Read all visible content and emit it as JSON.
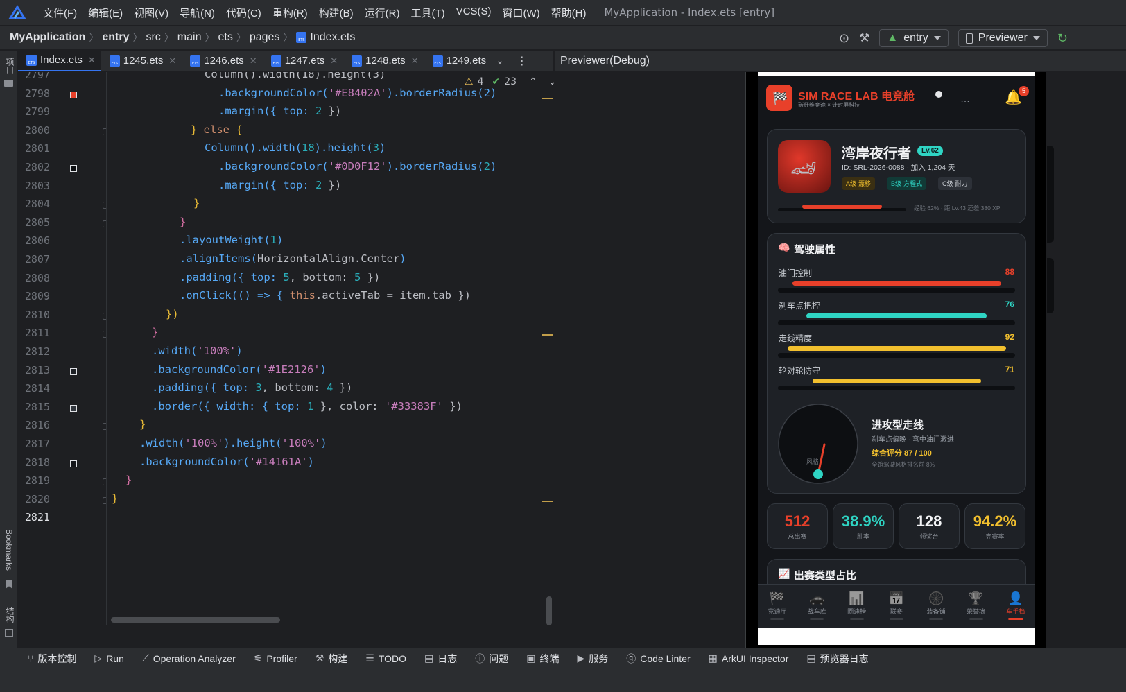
{
  "menu": {
    "items": [
      "文件(F)",
      "编辑(E)",
      "视图(V)",
      "导航(N)",
      "代码(C)",
      "重构(R)",
      "构建(B)",
      "运行(R)",
      "工具(T)",
      "VCS(S)",
      "窗口(W)",
      "帮助(H)"
    ],
    "window_title": "MyApplication - Index.ets [entry]"
  },
  "breadcrumb": [
    "MyApplication",
    "entry",
    "src",
    "main",
    "ets",
    "pages",
    "Index.ets"
  ],
  "toolbar": {
    "module": "entry",
    "device": "Previewer"
  },
  "left_strip": {
    "project": "项目",
    "bookmarks": "Bookmarks",
    "structure": "结构"
  },
  "tabs": [
    "Index.ets",
    "1245.ets",
    "1246.ets",
    "1247.ets",
    "1248.ets",
    "1249.ets"
  ],
  "editor": {
    "warnings": "4",
    "checks": "23",
    "line_numbers": [
      "2797",
      "2798",
      "2799",
      "2800",
      "2801",
      "2802",
      "2803",
      "2804",
      "2805",
      "2806",
      "2807",
      "2808",
      "2809",
      "2810",
      "2811",
      "2812",
      "2813",
      "2814",
      "2815",
      "2816",
      "2817",
      "2818",
      "2819",
      "2820",
      "2821"
    ]
  },
  "code_lines": [
    [
      [
        "Column().width(18).height(3)",
        "p"
      ]
    ],
    [
      [
        ".backgroundColor(",
        "f"
      ],
      [
        "'#E8402A'",
        "s"
      ],
      [
        ").borderRadius(2)",
        "f"
      ]
    ],
    [
      [
        ".margin({ top: ",
        "f"
      ],
      [
        "2",
        "n"
      ],
      [
        " })",
        "p"
      ]
    ],
    [
      [
        "} ",
        "br"
      ],
      [
        "else",
        "k"
      ],
      [
        " {",
        "br"
      ]
    ],
    [
      [
        "Column().width(",
        "f"
      ],
      [
        "18",
        "n"
      ],
      [
        ").height(",
        "f"
      ],
      [
        "3",
        "n"
      ],
      [
        ")",
        "f"
      ]
    ],
    [
      [
        ".backgroundColor(",
        "f"
      ],
      [
        "'#0D0F12'",
        "s"
      ],
      [
        ").borderRadius(",
        "f"
      ],
      [
        "2",
        "n"
      ],
      [
        ")",
        "f"
      ]
    ],
    [
      [
        ".margin({ top: ",
        "f"
      ],
      [
        "2",
        "n"
      ],
      [
        " })",
        "p"
      ]
    ],
    [
      [
        "}",
        "br"
      ]
    ],
    [
      [
        "}",
        "br2"
      ]
    ],
    [
      [
        ".layoutWeight(",
        "f"
      ],
      [
        "1",
        "n"
      ],
      [
        ")",
        "f"
      ]
    ],
    [
      [
        ".alignItems(",
        "f"
      ],
      [
        "HorizontalAlign.Center",
        "p"
      ],
      [
        ")",
        "f"
      ]
    ],
    [
      [
        ".padding({ top: ",
        "f"
      ],
      [
        "5",
        "n"
      ],
      [
        ", bottom: ",
        "p"
      ],
      [
        "5",
        "n"
      ],
      [
        " })",
        "p"
      ]
    ],
    [
      [
        ".onClick(() => { ",
        "f"
      ],
      [
        "this",
        "k"
      ],
      [
        ".activeTab = item.tab })",
        "p"
      ]
    ],
    [
      [
        "})",
        "br"
      ]
    ],
    [
      [
        "}",
        "br2"
      ]
    ],
    [
      [
        ".width(",
        "f"
      ],
      [
        "'100%'",
        "s"
      ],
      [
        ")",
        "f"
      ]
    ],
    [
      [
        ".backgroundColor(",
        "f"
      ],
      [
        "'#1E2126'",
        "s"
      ],
      [
        ")",
        "f"
      ]
    ],
    [
      [
        ".padding({ top: ",
        "f"
      ],
      [
        "3",
        "n"
      ],
      [
        ", bottom: ",
        "p"
      ],
      [
        "4",
        "n"
      ],
      [
        " })",
        "p"
      ]
    ],
    [
      [
        ".border({ width: { top: ",
        "f"
      ],
      [
        "1",
        "n"
      ],
      [
        " }, color: ",
        "p"
      ],
      [
        "'#33383F'",
        "s"
      ],
      [
        " })",
        "p"
      ]
    ],
    [
      [
        "}",
        "br"
      ]
    ],
    [
      [
        ".width(",
        "f"
      ],
      [
        "'100%'",
        "s"
      ],
      [
        ").height(",
        "f"
      ],
      [
        "'100%'",
        "s"
      ],
      [
        ")",
        "f"
      ]
    ],
    [
      [
        ".backgroundColor(",
        "f"
      ],
      [
        "'#14161A'",
        "s"
      ],
      [
        ")",
        "f"
      ]
    ],
    [
      [
        "}",
        "br2"
      ]
    ],
    [
      [
        "}",
        "br"
      ]
    ],
    [
      [
        "",
        "p"
      ]
    ]
  ],
  "previewer": {
    "title": "Previewer(Debug)"
  },
  "app": {
    "brand": "SIM RACE LAB 电竞舱",
    "tagline": "碳纤维竞速 × 计时屏科技",
    "notif_count": "5",
    "profile": {
      "name": "湾岸夜行者",
      "level": "Lv.62",
      "id_line": "ID: SRL-2026-0088 · 加入 1,204 天",
      "badges": [
        "A级·漂移",
        "B级·方程式",
        "C级·耐力"
      ],
      "xp_text": "经验 62% · 距 Lv.43 还差 380 XP",
      "xp_fraction": 0.62
    },
    "attributes_title": "驾驶属性",
    "attributes": [
      {
        "label": "油门控制",
        "value": "88",
        "color": "#e8402a"
      },
      {
        "label": "刹车点把控",
        "value": "76",
        "color": "#2fd5c4"
      },
      {
        "label": "走线精度",
        "value": "92",
        "color": "#f2c02e"
      },
      {
        "label": "轮对轮防守",
        "value": "71",
        "color": "#f2c02e"
      }
    ],
    "style": {
      "gauge_label": "风格",
      "name": "进攻型走线",
      "desc": "刹车点偏晚 · 弯中油门激进",
      "score": "综合评分 87 / 100",
      "rank": "全馆驾驶风格排名前 8%"
    },
    "stats": [
      {
        "value": "512",
        "label": "总出赛",
        "color": "#e8402a"
      },
      {
        "value": "38.9%",
        "label": "胜率",
        "color": "#2fd5c4"
      },
      {
        "value": "128",
        "label": "领奖台",
        "color": "#f2f3f5"
      },
      {
        "value": "94.2%",
        "label": "完赛率",
        "color": "#f2c02e"
      }
    ],
    "section2_title": "出赛类型占比",
    "nav": [
      {
        "label": "竞速厅",
        "icon": "🏁"
      },
      {
        "label": "战车库",
        "icon": "🚗"
      },
      {
        "label": "圈速榜",
        "icon": "📊"
      },
      {
        "label": "联赛",
        "icon": "📅"
      },
      {
        "label": "装备铺",
        "icon": "🛞"
      },
      {
        "label": "荣誉墙",
        "icon": "🏆"
      },
      {
        "label": "车手档",
        "icon": "👤"
      }
    ]
  },
  "bottom_bar": [
    "版本控制",
    "Run",
    "Operation Analyzer",
    "Profiler",
    "构建",
    "TODO",
    "日志",
    "问题",
    "终端",
    "服务",
    "Code Linter",
    "ArkUI Inspector",
    "预览器日志"
  ]
}
